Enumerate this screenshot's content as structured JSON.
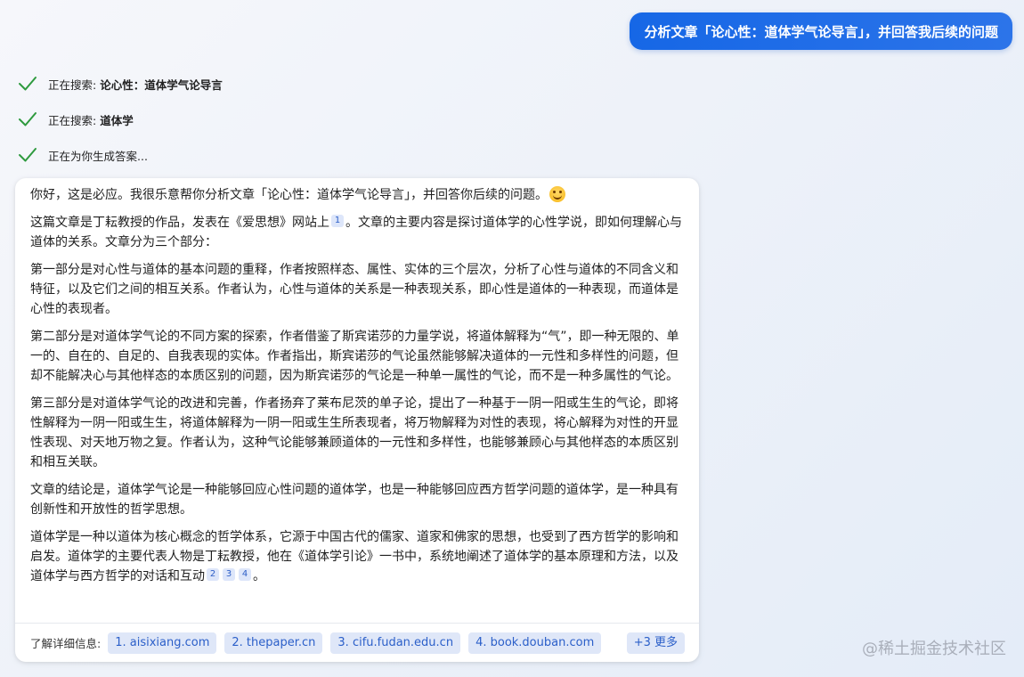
{
  "user_message": "分析文章「论心性：道体学气论导言」，并回答我后续的问题",
  "steps": [
    {
      "prefix": "正在搜索: ",
      "query": "论心性：道体学气论导言"
    },
    {
      "prefix": "正在搜索: ",
      "query": "道体学"
    },
    {
      "prefix": "正在为你生成答案...",
      "query": ""
    }
  ],
  "answer": {
    "p0": "你好，这是必应。我很乐意帮你分析文章「论心性：道体学气论导言」，并回答你后续的问题。",
    "p1a": "这篇文章是丁耘教授的作品，发表在《爱思想》网站上",
    "p1_cite": "1",
    "p1b": "。文章的主要内容是探讨道体学的心性学说，即如何理解心与道体的关系。文章分为三个部分：",
    "p2": "第一部分是对心性与道体的基本问题的重释，作者按照样态、属性、实体的三个层次，分析了心性与道体的不同含义和特征，以及它们之间的相互关系。作者认为，心性与道体的关系是一种表现关系，即心性是道体的一种表现，而道体是心性的表现者。",
    "p3": "第二部分是对道体学气论的不同方案的探索，作者借鉴了斯宾诺莎的力量学说，将道体解释为“气”，即一种无限的、单一的、自在的、自足的、自我表现的实体。作者指出，斯宾诺莎的气论虽然能够解决道体的一元性和多样性的问题，但却不能解决心与其他样态的本质区别的问题，因为斯宾诺莎的气论是一种单一属性的气论，而不是一种多属性的气论。",
    "p4": "第三部分是对道体学气论的改进和完善，作者扬弃了莱布尼茨的单子论，提出了一种基于一阴一阳或生生的气论，即将性解释为一阴一阳或生生，将道体解释为一阴一阳或生生所表现者，将万物解释为对性的表现，将心解释为对性的开显性表现、对天地万物之复。作者认为，这种气论能够兼顾道体的一元性和多样性，也能够兼顾心与其他样态的本质区别和相互关联。",
    "p5": "文章的结论是，道体学气论是一种能够回应心性问题的道体学，也是一种能够回应西方哲学问题的道体学，是一种具有创新性和开放性的哲学思想。",
    "p6a": "道体学是一种以道体为核心概念的哲学体系，它源于中国古代的儒家、道家和佛家的思想，也受到了西方哲学的影响和启发。道体学的主要代表人物是丁耘教授，他在《道体学引论》一书中，系统地阐述了道体学的基本原理和方法，以及道体学与西方哲学的对话和互动",
    "p6_cites": [
      "2",
      "3",
      "4"
    ],
    "p6b": "。"
  },
  "sources": {
    "label": "了解详细信息:",
    "items": [
      "1. aisixiang.com",
      "2. thepaper.cn",
      "3. cifu.fudan.edu.cn",
      "4. book.douban.com"
    ],
    "more": "+3 更多"
  },
  "watermark": "@稀土掘金技术社区",
  "colors": {
    "accent": "#1667e6",
    "check": "#2e9a3e",
    "chip_bg": "#dfe7f8",
    "chip_text": "#2b5fc9"
  }
}
